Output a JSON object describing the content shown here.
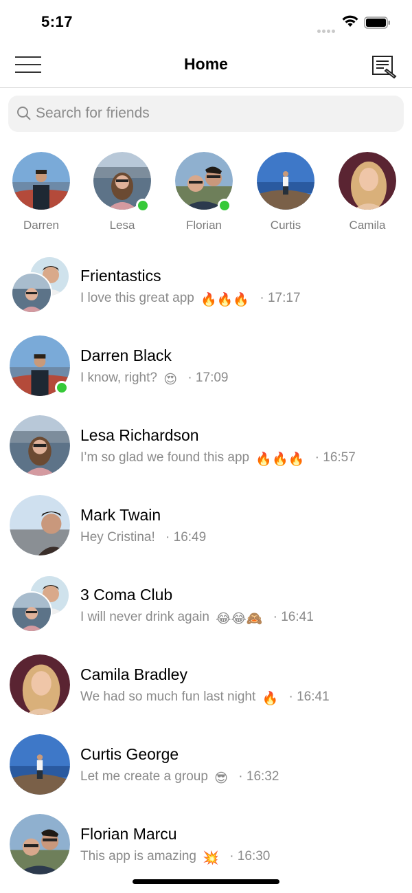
{
  "status": {
    "time": "5:17"
  },
  "header": {
    "title": "Home",
    "menu_icon": "hamburger-menu-icon",
    "compose_icon": "compose-icon"
  },
  "search": {
    "placeholder": "Search for friends"
  },
  "stories": [
    {
      "name": "Darren",
      "online": false
    },
    {
      "name": "Lesa",
      "online": true
    },
    {
      "name": "Florian",
      "online": true
    },
    {
      "name": "Curtis",
      "online": false
    },
    {
      "name": "Camila",
      "online": false
    }
  ],
  "chats": [
    {
      "title": "Frientastics",
      "message": "I love this great app",
      "emoji": "🔥🔥🔥",
      "time": "· 17:17",
      "group": true,
      "online": false
    },
    {
      "title": "Darren Black",
      "message": "I know, right?",
      "emoji": "😍",
      "time": "· 17:09",
      "group": false,
      "online": true
    },
    {
      "title": "Lesa Richardson",
      "message": "I’m so glad we found this app",
      "emoji": "🔥🔥🔥",
      "time": "· 16:57",
      "group": false,
      "online": false
    },
    {
      "title": "Mark Twain",
      "message": "Hey Cristina!",
      "emoji": "",
      "time": "· 16:49",
      "group": false,
      "online": false
    },
    {
      "title": "3 Coma Club",
      "message": "I will never drink again",
      "emoji": "😂😂🙈",
      "time": "· 16:41",
      "group": true,
      "online": false
    },
    {
      "title": "Camila Bradley",
      "message": "We had so much fun last night",
      "emoji": "🔥",
      "time": "· 16:41",
      "group": false,
      "online": false
    },
    {
      "title": "Curtis George",
      "message": "Let me create a group",
      "emoji": "😎",
      "time": "· 16:32",
      "group": false,
      "online": false
    },
    {
      "title": "Florian Marcu",
      "message": "This app is amazing",
      "emoji": "💥",
      "time": "· 16:30",
      "group": false,
      "online": false
    }
  ],
  "colors": {
    "online": "#36c938",
    "secondary_text": "#8a8a8a",
    "search_bg": "#f2f2f2"
  }
}
